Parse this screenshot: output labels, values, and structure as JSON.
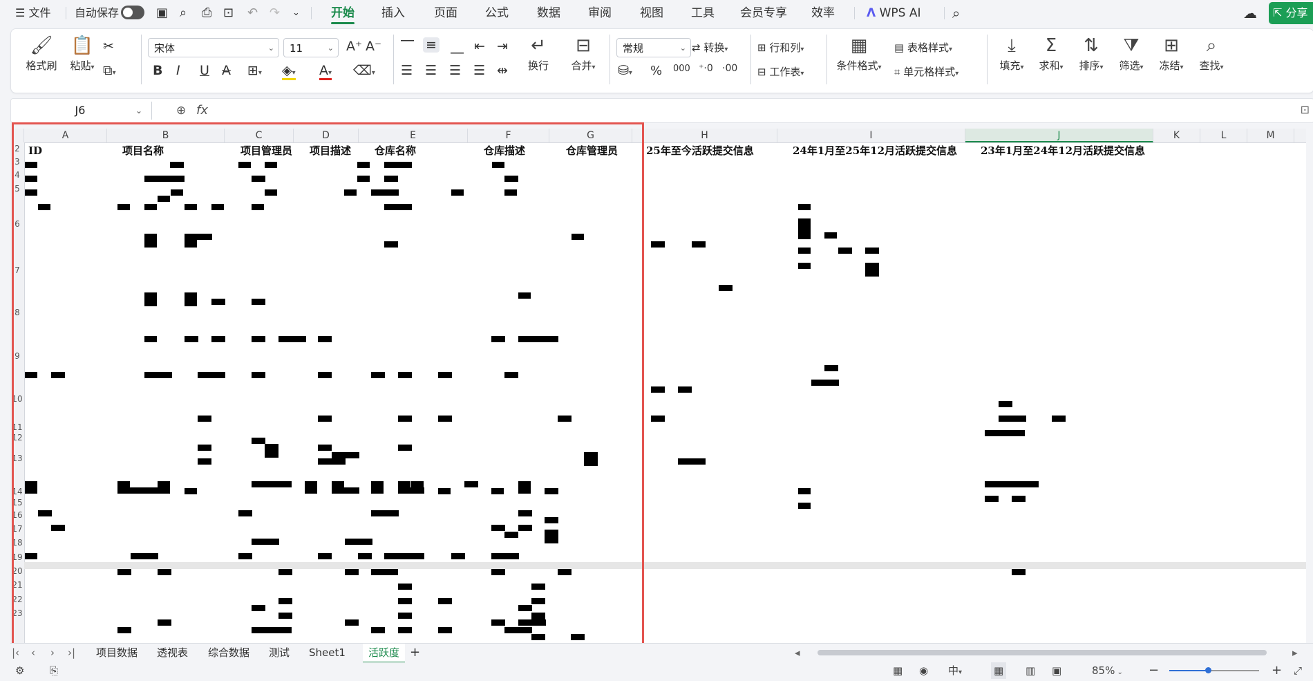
{
  "menubar": {
    "file": "文件",
    "autosave": "自动保存",
    "tabs": [
      "开始",
      "插入",
      "页面",
      "公式",
      "数据",
      "审阅",
      "视图",
      "工具",
      "会员专享",
      "效率"
    ],
    "active_tab": "开始",
    "wps_ai": "WPS AI",
    "share": "分享"
  },
  "ribbon": {
    "format_painter": "格式刷",
    "paste": "粘贴",
    "font_name": "宋体",
    "font_size": "11",
    "wrap": "换行",
    "merge": "合并",
    "number_format": "常规",
    "convert": "转换",
    "rows_cols": "行和列",
    "worksheet": "工作表",
    "cond_format": "条件格式",
    "table_style": "表格样式",
    "cell_style": "单元格样式",
    "fill": "填充",
    "sum": "求和",
    "sort": "排序",
    "filter": "筛选",
    "freeze": "冻结",
    "find": "查找",
    "percent": "%",
    "thousands": "000"
  },
  "formula_bar": {
    "cell_ref": "J6",
    "fx": "fx",
    "value": ""
  },
  "grid": {
    "columns": [
      "A",
      "B",
      "C",
      "D",
      "E",
      "F",
      "G",
      "H",
      "I",
      "J",
      "K",
      "L",
      "M"
    ],
    "selected_column": "J",
    "headers": [
      "ID",
      "项目名称",
      "项目管理员",
      "项目描述",
      "仓库名称",
      "仓库描述",
      "仓库管理员",
      "25年至今活跃提交信息",
      "24年1月至25年12月活跃提交信息",
      "23年1月至24年12月活跃提交信息"
    ],
    "row_numbers": [
      "2",
      "3",
      "4",
      "5",
      "6",
      "7",
      "8",
      "9",
      "10",
      "11",
      "12",
      "13",
      "14",
      "15",
      "16",
      "17",
      "18",
      "19",
      "20",
      "21",
      "22",
      "23"
    ]
  },
  "sheets": {
    "tabs": [
      "项目数据",
      "透视表",
      "综合数据",
      "测试",
      "Sheet1",
      "活跃度"
    ],
    "active": "活跃度",
    "add": "+"
  },
  "status": {
    "zoom": "85%"
  },
  "colors": {
    "accent": "#1b8a4c",
    "highlight_box": "#e35550",
    "share_bg": "#1b9e55"
  }
}
